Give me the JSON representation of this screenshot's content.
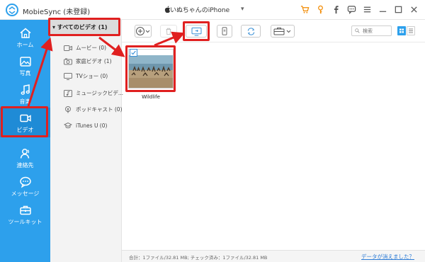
{
  "app": {
    "title": "MobieSync (未登録)",
    "device_name": "いぬちゃんのiPhone",
    "caret": "▾"
  },
  "titlebar_icons": [
    {
      "name": "cart-icon",
      "glyph": "🛒"
    },
    {
      "name": "key-icon",
      "glyph": "⚲"
    },
    {
      "name": "facebook-icon",
      "glyph": "f"
    },
    {
      "name": "chat-icon",
      "glyph": "▢"
    },
    {
      "name": "menu-icon",
      "glyph": "≡"
    },
    {
      "name": "minimize-icon",
      "glyph": "—"
    },
    {
      "name": "maximize-icon",
      "glyph": "☐"
    },
    {
      "name": "close-icon",
      "glyph": "✕"
    }
  ],
  "nav": {
    "items": [
      {
        "label": "ホーム",
        "icon": "home-icon"
      },
      {
        "label": "写真",
        "icon": "photo-icon"
      },
      {
        "label": "音楽",
        "icon": "music-icon"
      },
      {
        "label": "ビデオ",
        "icon": "video-icon"
      },
      {
        "label": "連絡先",
        "icon": "contacts-icon"
      },
      {
        "label": "メッセージ",
        "icon": "message-icon"
      },
      {
        "label": "ツールキット",
        "icon": "toolbox-icon"
      }
    ],
    "active_index": 3
  },
  "categories": {
    "all": "▾ すべてのビデオ (1)",
    "items": [
      {
        "label": "ムービー (0)",
        "icon": "movie-icon"
      },
      {
        "label": "家庭ビデオ (1)",
        "icon": "home-video-icon"
      },
      {
        "label": "TVショー (0)",
        "icon": "tv-show-icon"
      },
      {
        "label": "ミュージックビデ...",
        "icon": "music-video-icon"
      },
      {
        "label": "ポッドキャスト (0)",
        "icon": "podcast-icon"
      },
      {
        "label": "iTunes U (0)",
        "icon": "itunes-u-icon"
      }
    ]
  },
  "search": {
    "placeholder": "検索"
  },
  "content": {
    "items": [
      {
        "title": "Wildlife",
        "checked": true
      }
    ]
  },
  "status": {
    "summary": "合計：1ファイル/32.81 MB; チェック済み：1ファイル/32.81 MB",
    "link": "データが消えました？"
  },
  "colors": {
    "accent": "#2da0ec",
    "highlight": "#e02020",
    "orange": "#f28a00"
  }
}
